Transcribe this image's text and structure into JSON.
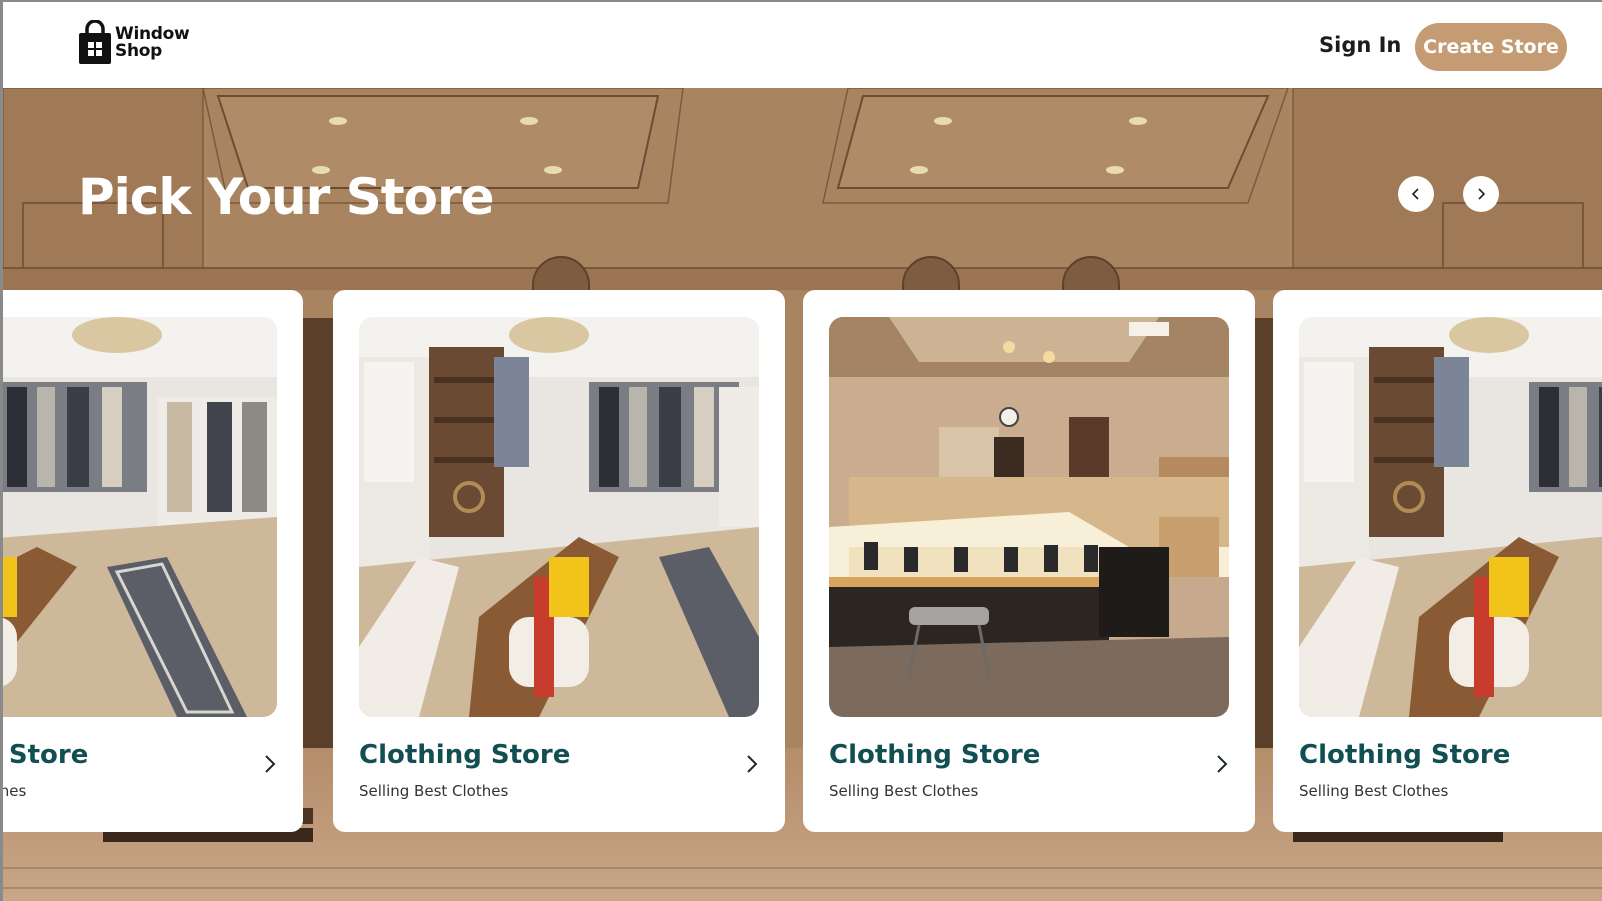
{
  "header": {
    "logo_line1": "Window",
    "logo_line2": "Shop",
    "sign_in": "Sign In",
    "create_store": "Create Store"
  },
  "hero": {
    "title": "Pick Your Store"
  },
  "cards": [
    {
      "title": "Clothing Store",
      "subtitle": "Selling Best Clothes",
      "image": "clothing-boutique"
    },
    {
      "title": "Clothing Store",
      "subtitle": "Selling Best Clothes",
      "image": "clothing-boutique"
    },
    {
      "title": "Clothing Store",
      "subtitle": "Selling Best Clothes",
      "image": "jewelry-showroom"
    },
    {
      "title": "Clothing Store",
      "subtitle": "Selling Best Clothes",
      "image": "clothing-boutique"
    }
  ],
  "colors": {
    "accent": "#c59b73",
    "card_title": "#124f53",
    "hero_bg": "#a27c59"
  },
  "icons": [
    "shopping-bag-icon",
    "chevron-left-icon",
    "chevron-right-icon"
  ]
}
